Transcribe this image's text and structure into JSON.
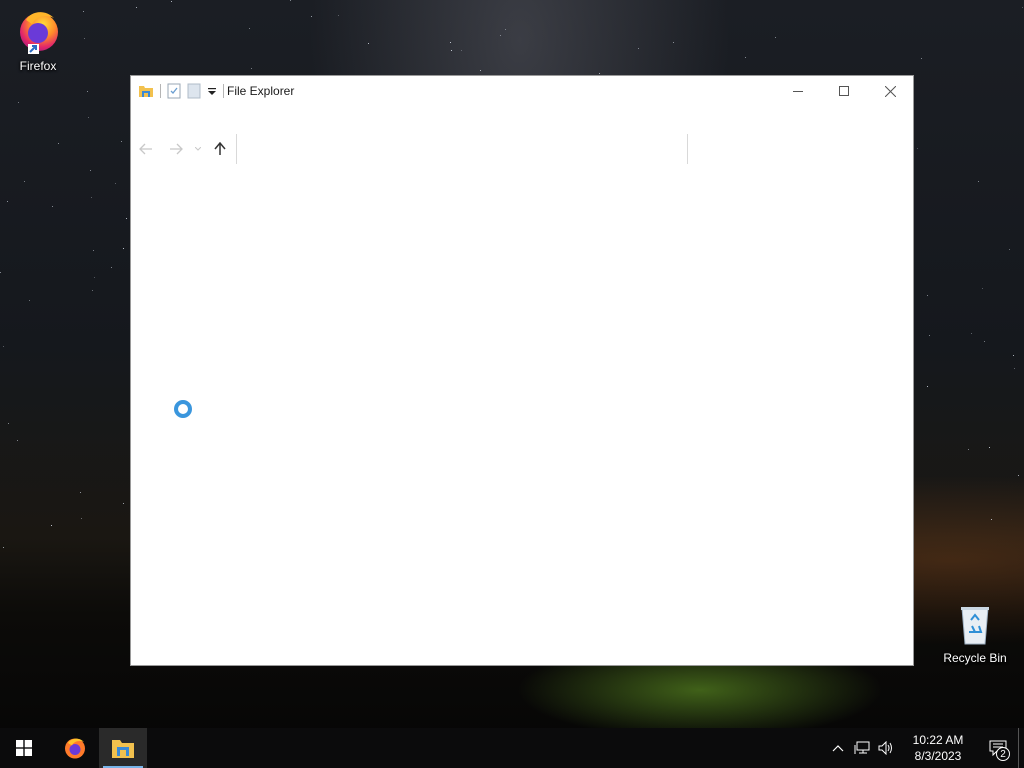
{
  "desktop": {
    "icons": [
      {
        "label": "Firefox",
        "icon": "firefox-icon"
      },
      {
        "label": "Recycle Bin",
        "icon": "recycle-bin-icon"
      }
    ]
  },
  "window": {
    "title": "File Explorer",
    "quick_access": [
      "folder-icon",
      "properties-icon",
      "new-folder-icon",
      "customize-dropdown-icon"
    ],
    "controls": [
      "minimize-icon",
      "maximize-icon",
      "close-icon"
    ],
    "nav": [
      "back-arrow-icon",
      "forward-arrow-icon",
      "recent-locations-chevron-icon",
      "up-arrow-icon"
    ],
    "status": "loading",
    "accent": "#3a96dd"
  },
  "taskbar": {
    "apps": [
      {
        "icon": "start-icon"
      },
      {
        "icon": "firefox-icon"
      },
      {
        "icon": "file-explorer-icon",
        "active": true
      }
    ],
    "tray": [
      "chevron-up-icon",
      "network-icon",
      "volume-icon"
    ],
    "clock": {
      "time": "10:22 AM",
      "date": "8/3/2023"
    },
    "notifications": {
      "count": "2"
    },
    "colors": {
      "background": "#0b0b0c",
      "active_indicator": "#78b4e8"
    }
  }
}
